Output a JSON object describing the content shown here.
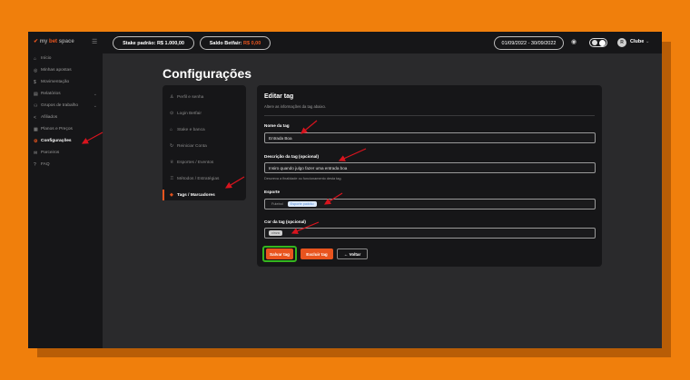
{
  "topbar": {
    "logo_prefix": "my",
    "logo_brand": "bet",
    "logo_suffix": "space",
    "stake_label": "Stake padrão: R$ 1.000,00",
    "balance_label": "Saldo Betfair:",
    "balance_value": "R$ 0,00",
    "date_range": "01/09/2022 - 30/09/2022",
    "avatar_letter": "R",
    "club_label": "Clube"
  },
  "sidebar": {
    "items": [
      {
        "label": "Início",
        "icon": "home-icon"
      },
      {
        "label": "Minhas apostas",
        "icon": "ticket-icon"
      },
      {
        "label": "Movimentação",
        "icon": "money-icon"
      },
      {
        "label": "Relatórios",
        "icon": "report-icon"
      },
      {
        "label": "Grupos de trabalho",
        "icon": "group-icon"
      },
      {
        "label": "Afiliados",
        "icon": "share-icon"
      },
      {
        "label": "Planos e Preços",
        "icon": "plans-icon"
      },
      {
        "label": "Configurações",
        "icon": "settings-icon"
      },
      {
        "label": "Parceiros",
        "icon": "partners-icon"
      },
      {
        "label": "FAQ",
        "icon": "help-icon"
      }
    ]
  },
  "page": {
    "title": "Configurações"
  },
  "settings_menu": {
    "items": [
      {
        "label": "Perfil e senha",
        "icon": "user-icon"
      },
      {
        "label": "Login Betfair",
        "icon": "login-icon"
      },
      {
        "label": "Stake e banca",
        "icon": "bank-icon"
      },
      {
        "label": "Reiniciar Conta",
        "icon": "refresh-icon"
      },
      {
        "label": "Esportes / Eventos",
        "icon": "trophy-icon"
      },
      {
        "label": "Métodos / Estratégias",
        "icon": "strategy-icon"
      },
      {
        "label": "Tags / Marcadores",
        "icon": "tag-icon"
      }
    ]
  },
  "form": {
    "title": "Editar tag",
    "subtitle": "Altere as informações da tag abaixo.",
    "name_label": "Nome da tag",
    "name_value": "Entrada Boa",
    "desc_label": "Descrição da tag (opcional)",
    "desc_value": "Insiro quando julgo fazer uma entrada boa",
    "desc_hint": "Descreva a finalidade ou funcionamento desta tag.",
    "sport_label": "Esporte",
    "sport_value": "Futebol",
    "sport_chip": "Esporte padrão",
    "color_label": "Cor da tag (opcional)",
    "color_value": "cinza",
    "save_label": "Salvar tag",
    "delete_label": "Excluir tag",
    "back_label": "Voltar"
  },
  "colors": {
    "accent": "#e9541e",
    "background": "#f07f0c",
    "highlight": "#35b51e",
    "annotation": "#d8141e"
  }
}
